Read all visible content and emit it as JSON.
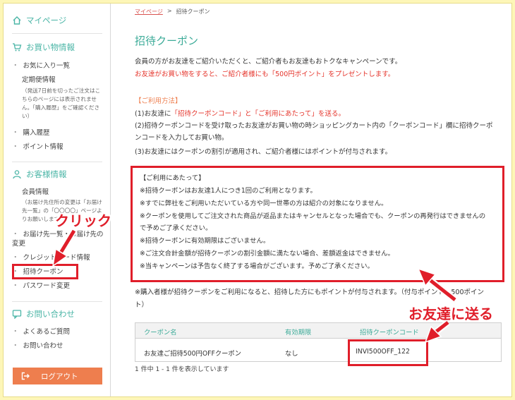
{
  "sidebar": {
    "mypage": "マイページ",
    "shopping_header": "お買い物情報",
    "favorites": "お気に入り一覧",
    "subscription": "定期便情報",
    "subscription_note": "（発送7日前を切ったご注文はこちらのページには表示されません。「購入履歴」をご確認ください）",
    "purchase_history": "購入履歴",
    "points": "ポイント情報",
    "customer_header": "お客様情報",
    "member_info": "会員情報",
    "member_note": "（お届け先住所の変更は「お届け先一覧」の「〇〇〇〇」ページよりお願いします）",
    "delivery_change": "お届け先一覧・お届け先の変更",
    "credit_card": "クレジットカード情報",
    "invite_coupon": "招待クーポン",
    "password_change": "パスワード変更",
    "contact_header": "お問い合わせ",
    "faq": "よくあるご質問",
    "contact": "お問い合わせ",
    "logout": "ログアウト"
  },
  "breadcrumb": {
    "home": "マイページ",
    "sep": ">",
    "current": "招待クーポン"
  },
  "page_title": "招待クーポン",
  "intro": {
    "line1": "会員の方がお友達をご紹介いただくと、ご紹介者もお友達もおトクなキャンペーンです。",
    "line2": "お友達がお買い物をすると、ご紹介者様にも「500円ポイント」をプレゼントします。"
  },
  "usage": {
    "heading": "【ご利用方法】",
    "step1_pre": "(1)お友達に",
    "step1_em": "「招待クーポンコード」と「ご利用にあたって」を送る。",
    "step2a": "(2)招待クーポンコードを受け取ったお友達がお買い物の時ショッピングカート内の「クーポンコード」欄に招待クーポ",
    "step2b": "ンコードを入力してお買い物。",
    "step3": "(3)お友達にはクーポンの割引が適用され、ご紹介者様にはポイントが付与されます。"
  },
  "notes": {
    "heading": "【ご利用にあたって】",
    "items": [
      "※招待クーポンはお友達1人につき1回のご利用となります。",
      "※すでに弊社をご利用いただいている方や同一世帯の方は紹介の対象になりません。",
      "※クーポンを使用してご注文された商品が返品またはキャンセルとなった場合でも、クーポンの再発行はできませんの",
      "で予めご了承ください。",
      "※招待クーポンに有効期限はございません。",
      "※ご注文合計金額が招待クーポンの割引金額に満たない場合、差額返金はできません。",
      "※当キャンペーンは予告なく終了する場合がございます。予めご了承ください。"
    ]
  },
  "after_note": {
    "line1": "※購入者様が招待クーポンをご利用になると、招待した方にもポイントが付与されます。（付与ポイント：500ポイン",
    "line2": "ト）"
  },
  "table": {
    "headers": [
      "クーポン名",
      "有効期限",
      "招待クーポンコード"
    ],
    "rows": [
      [
        "お友達ご招待500円OFFクーポン",
        "なし",
        "INVI500OFF_122"
      ]
    ],
    "count": "1 件中 1 - 1 件を表示しています"
  },
  "callouts": {
    "click": "クリック",
    "send_to_friend": "お友達に送る"
  },
  "colors": {
    "accent": "#3cab98",
    "red": "#e01e2a",
    "orange": "#ee7e4e",
    "background": "#fdf6b8"
  }
}
